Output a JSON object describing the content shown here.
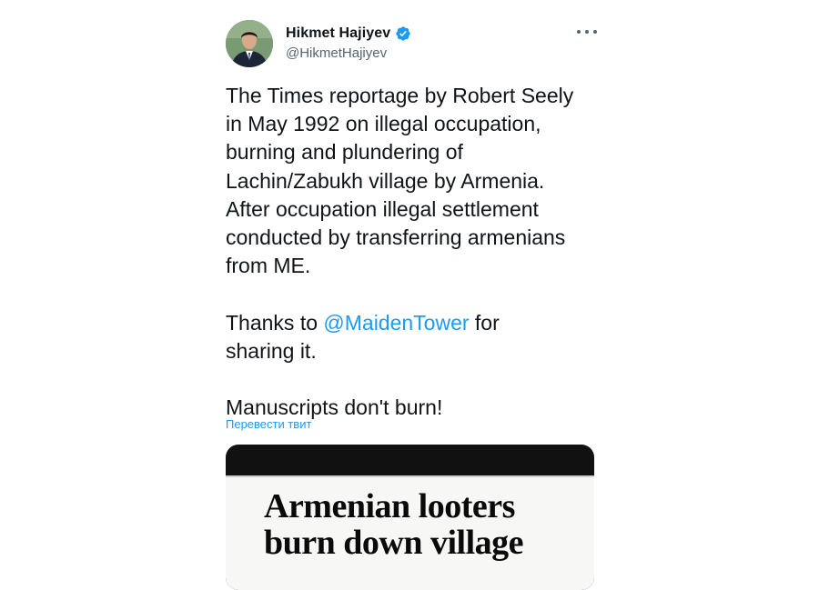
{
  "author": {
    "name": "Hikmet Hajiyev",
    "handle": "@HikmetHajiyev",
    "verified_icon": "verified-badge-icon",
    "verified_color": "#1d9bf0"
  },
  "more_menu_icon": "more-dots-icon",
  "tweet": {
    "line1": "The Times reportage by Robert Seely",
    "line2": "in May 1992 on illegal occupation,",
    "line3": "burning and plundering of",
    "line4": "Lachin/Zabukh village by  Armenia.",
    "line5": "After occupation illegal settlement",
    "line6": "conducted by transferring armenians",
    "line7": "from ME.",
    "thanks_prefix": "Thanks to ",
    "mention": "@MaidenTower",
    "thanks_suffix": " for",
    "thanks_line2": "sharing it.",
    "closing": "Manuscripts don't burn!"
  },
  "translate_label": "Перевести твит",
  "media": {
    "headline_line1": "Armenian looters",
    "headline_line2": "burn down village"
  },
  "colors": {
    "accent": "#1d9bf0",
    "text": "#0f1419",
    "secondary": "#536471"
  }
}
